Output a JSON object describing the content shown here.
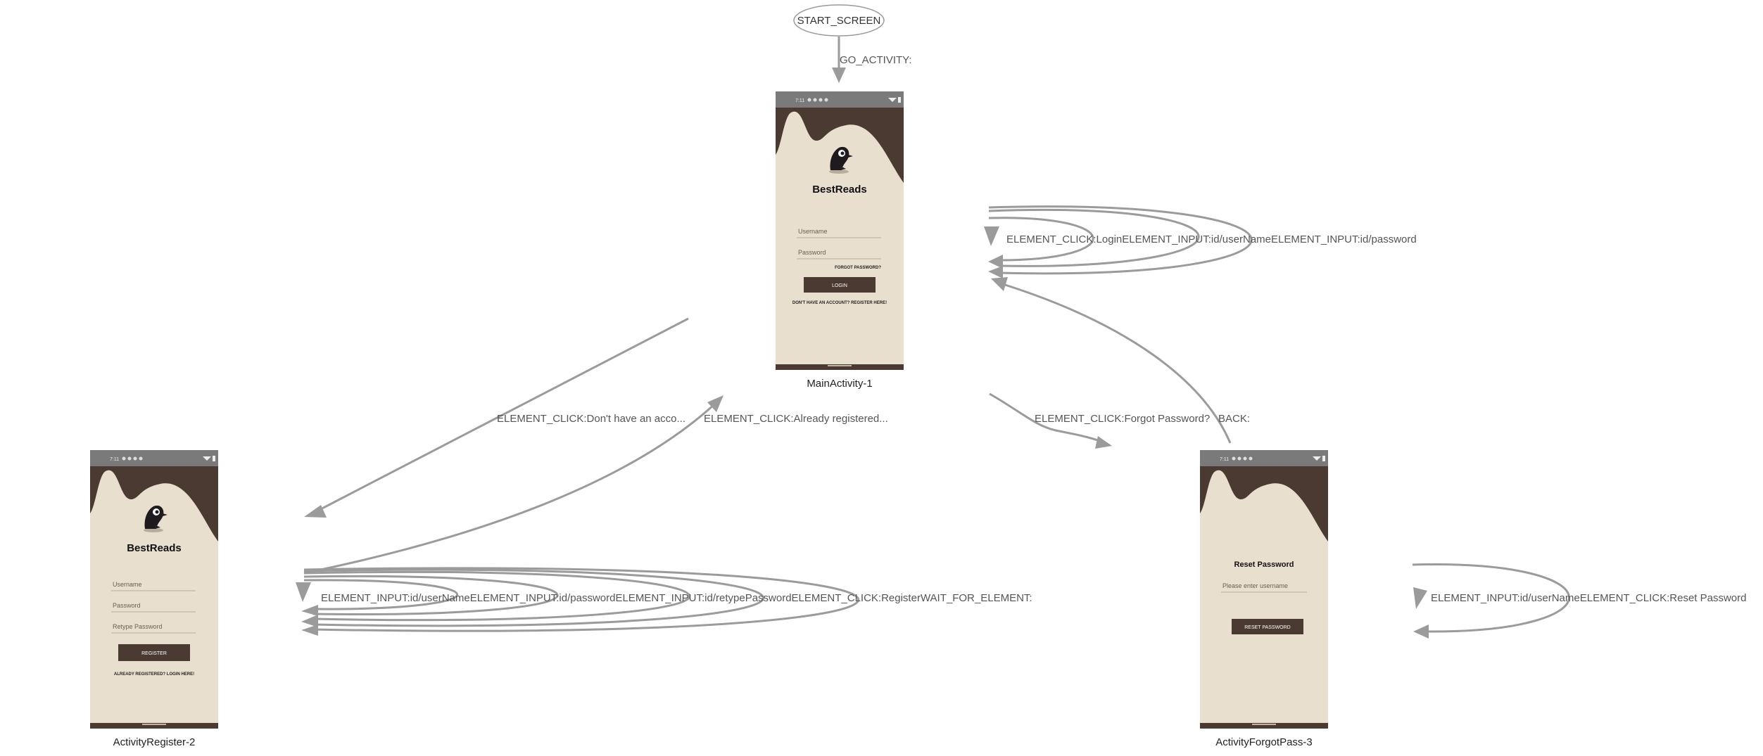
{
  "start_node": {
    "label": "START_SCREEN"
  },
  "screens": {
    "main": {
      "caption": "MainActivity-1",
      "status_time": "7:11",
      "app_title": "BestReads",
      "username_placeholder": "Username",
      "password_placeholder": "Password",
      "forgot_link": "FORGOT PASSWORD?",
      "login_button": "LOGIN",
      "register_link": "DON'T HAVE AN ACCOUNT? REGISTER HERE!"
    },
    "register": {
      "caption": "ActivityRegister-2",
      "status_time": "7:11",
      "app_title": "BestReads",
      "username_placeholder": "Username",
      "password_placeholder": "Password",
      "retype_placeholder": "Retype Password",
      "register_button": "REGISTER",
      "login_link": "ALREADY REGISTERED? LOGIN HERE!"
    },
    "forgot": {
      "caption": "ActivityForgotPass-3",
      "status_time": "7:11",
      "title": "Reset Password",
      "username_placeholder": "Please enter username",
      "reset_button": "RESET PASSWORD"
    }
  },
  "edges": {
    "go_activity": "GO_ACTIVITY:",
    "main_self_loops": "ELEMENT_CLICK:LoginELEMENT_INPUT:id/userNameELEMENT_INPUT:id/password",
    "main_to_register": "ELEMENT_CLICK:Don't have an acco...",
    "register_to_main": "ELEMENT_CLICK:Already registered...",
    "main_to_forgot": "ELEMENT_CLICK:Forgot Password?",
    "forgot_back": "BACK:",
    "register_self_loops": "ELEMENT_INPUT:id/userNameELEMENT_INPUT:id/passwordELEMENT_INPUT:id/retypePasswordELEMENT_CLICK:RegisterWAIT_FOR_ELEMENT:",
    "forgot_self_loops": "ELEMENT_INPUT:id/userNameELEMENT_CLICK:Reset Password"
  },
  "colors": {
    "edge": "#9b9b9b",
    "phone_bg": "#e8dfcf",
    "phone_dark": "#4a3a31",
    "status_bar": "#7a7a7a"
  }
}
